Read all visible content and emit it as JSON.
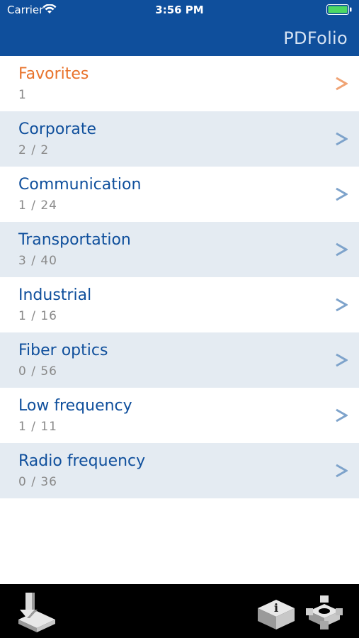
{
  "status_bar": {
    "carrier": "Carrier",
    "time": "3:56 PM"
  },
  "header": {
    "title": "PDFolio"
  },
  "colors": {
    "brand_blue": "#0f4f9c",
    "favorite_orange": "#e8722a",
    "row_alt": "#e4ebf2"
  },
  "categories": [
    {
      "title": "Favorites",
      "count": "1"
    },
    {
      "title": "Corporate",
      "count": "2 / 2"
    },
    {
      "title": "Communication",
      "count": "1 / 24"
    },
    {
      "title": "Transportation",
      "count": "3 / 40"
    },
    {
      "title": "Industrial",
      "count": "1 / 16"
    },
    {
      "title": "Fiber optics",
      "count": "0 / 56"
    },
    {
      "title": "Low frequency",
      "count": "1 / 11"
    },
    {
      "title": "Radio frequency",
      "count": "0 / 36"
    }
  ],
  "toolbar": {
    "icons": [
      "download-icon",
      "info-icon",
      "settings-gear-icon"
    ]
  }
}
